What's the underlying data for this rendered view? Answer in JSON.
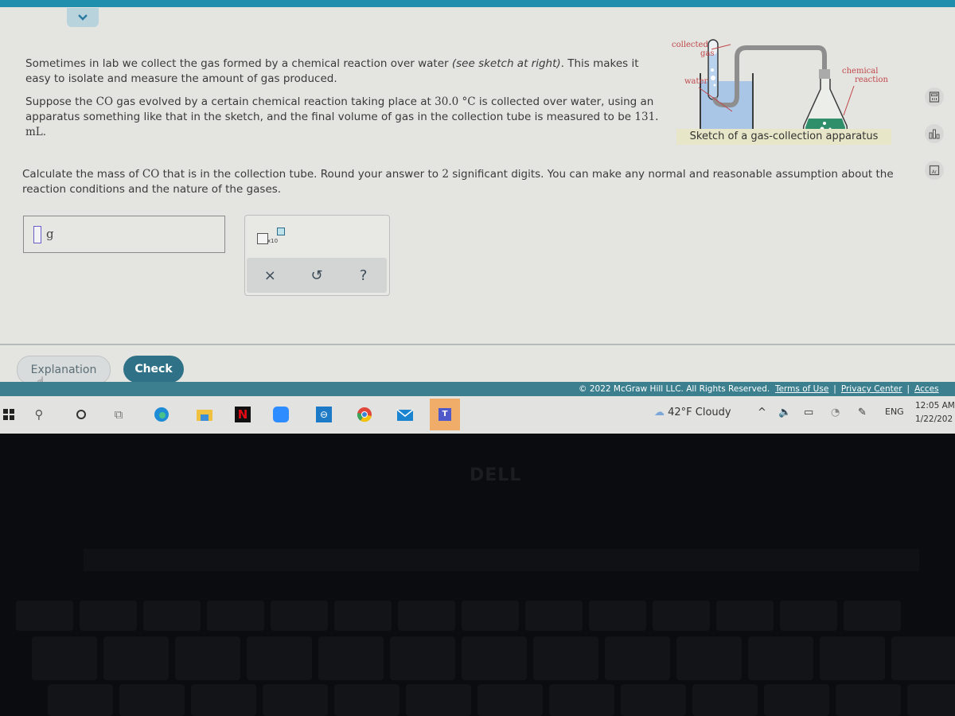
{
  "question": {
    "p1_a": "Sometimes in lab we collect the gas formed by a chemical reaction over water ",
    "p1_italic": "(see sketch at right)",
    "p1_b": ". This makes it easy to isolate and measure the amount of gas produced.",
    "p2_a": "Suppose the ",
    "p2_gas": "CO",
    "p2_b": " gas evolved by a certain chemical reaction taking place at ",
    "p2_temp": "30.0 °C",
    "p2_c": " is collected over water, using an apparatus something like that in the sketch, and the final volume of gas in the collection tube is measured to be ",
    "p2_vol": "131. mL",
    "p2_d": ".",
    "p3_a": "Calculate the mass of ",
    "p3_gas": "CO",
    "p3_b": " that is in the collection tube. Round your answer to ",
    "p3_digits": "2",
    "p3_c": " significant digits. You can make any normal and reasonable assumption about the reaction conditions and the nature of the gases."
  },
  "sketch": {
    "label_collected": "collected",
    "label_gas": "gas",
    "label_water": "water",
    "label_chemical": "chemical",
    "label_reaction": "reaction",
    "caption": "Sketch of a gas-collection apparatus"
  },
  "answer": {
    "value": "",
    "unit": "g"
  },
  "tools": {
    "sci_notation_label": "x10",
    "clear_symbol": "×",
    "undo_symbol": "↺",
    "help_symbol": "?"
  },
  "buttons": {
    "explanation": "Explanation",
    "check": "Check"
  },
  "side_tools": [
    "calculator-icon",
    "chart-icon",
    "periodic-table-icon"
  ],
  "footer": {
    "copyright": "© 2022 McGraw Hill LLC. All Rights Reserved.",
    "terms": "Terms of Use",
    "privacy": "Privacy Center",
    "accessibility": "Acces"
  },
  "taskbar": {
    "weather": "42°F  Cloudy",
    "language": "ENG",
    "time": "12:05 AM",
    "date": "1/22/202"
  },
  "laptop": {
    "brand": "DELL"
  }
}
